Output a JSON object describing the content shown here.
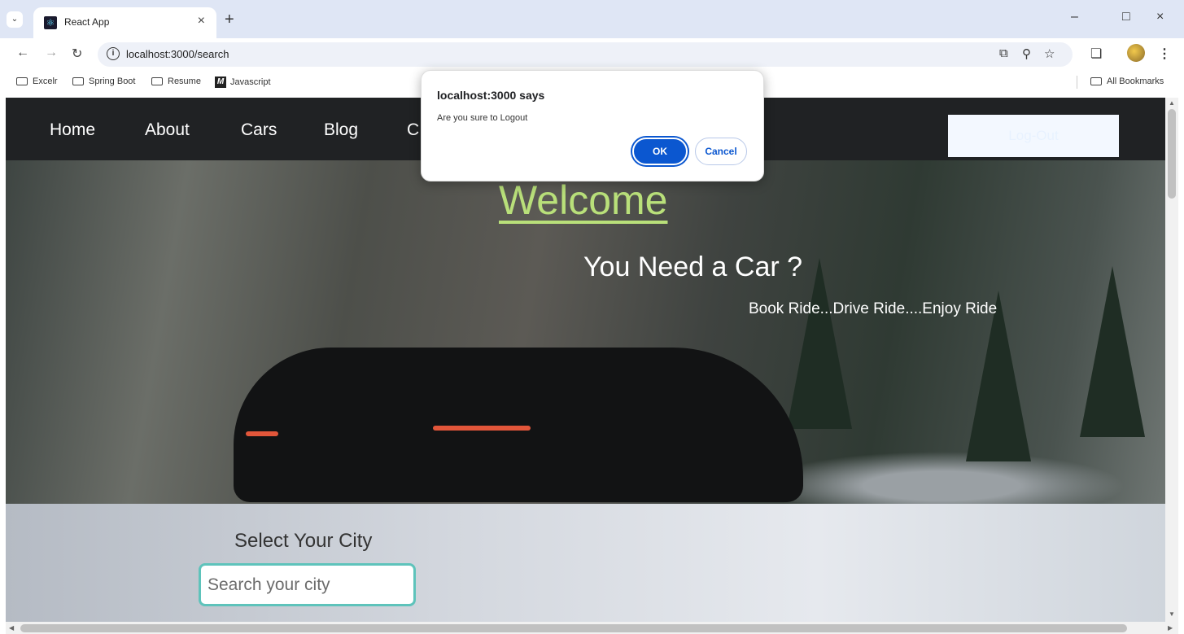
{
  "browser": {
    "tab_title": "React App",
    "url": "localhost:3000/search",
    "bookmarks": [
      "Excelr",
      "Spring Boot",
      "Resume",
      "Javascript"
    ],
    "all_bookmarks": "All Bookmarks"
  },
  "nav": {
    "links": [
      "Home",
      "About",
      "Cars",
      "Blog",
      "C"
    ],
    "logout": "Log-Out"
  },
  "hero": {
    "welcome": "Welcome",
    "subtitle": "You Need a Car ?",
    "tagline": "Book Ride...Drive Ride....Enjoy Ride"
  },
  "city": {
    "title": "Select Your City",
    "placeholder": "Search your city"
  },
  "dialog": {
    "title": "localhost:3000 says",
    "message": "Are you sure to Logout",
    "ok": "OK",
    "cancel": "Cancel"
  },
  "colors": {
    "accent": "#0b57d0",
    "welcome": "#b9e07a",
    "input_border": "#5ec3bb",
    "navbar": "#202224"
  },
  "icons": [
    "chevron-down-icon",
    "react-icon",
    "close-icon",
    "plus-icon",
    "minimize-icon",
    "restore-icon",
    "back-icon",
    "forward-icon",
    "reload-icon",
    "info-icon",
    "install-icon",
    "zoom-icon",
    "star-icon",
    "extensions-icon",
    "profile-icon",
    "menu-dots-icon",
    "folder-icon"
  ]
}
